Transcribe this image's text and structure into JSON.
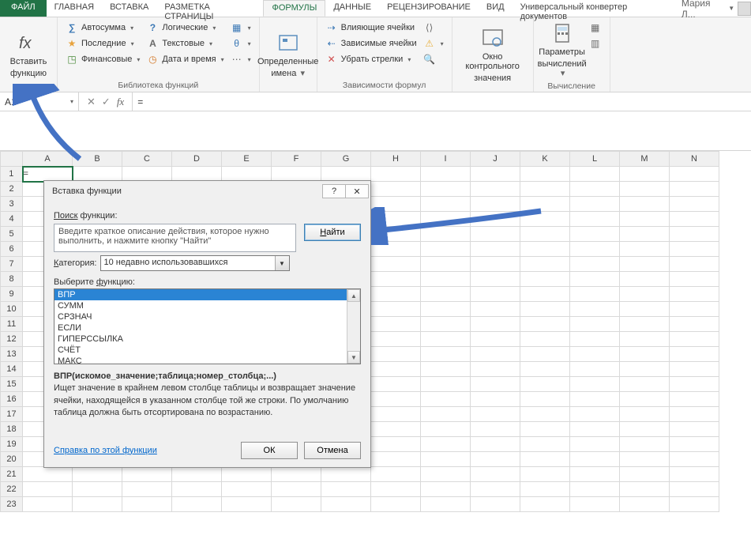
{
  "tabs": {
    "file": "ФАЙЛ",
    "home": "ГЛАВНАЯ",
    "insert": "ВСТАВКА",
    "layout": "РАЗМЕТКА СТРАНИЦЫ",
    "formulas": "ФОРМУЛЫ",
    "data": "ДАННЫЕ",
    "review": "РЕЦЕНЗИРОВАНИЕ",
    "view": "ВИД",
    "converter": "Универсальный конвертер документов",
    "user": "Мария Л..."
  },
  "ribbon": {
    "insert_fn": {
      "top": "Вставить",
      "bottom": "функцию"
    },
    "lib": {
      "autosum": "Автосумма",
      "recent": "Последние",
      "financial": "Финансовые",
      "logical": "Логические",
      "text": "Текстовые",
      "datetime": "Дата и время",
      "group_label": "Библиотека функций"
    },
    "names": {
      "btn_top": "Определенные",
      "btn_bottom": "имена"
    },
    "deps": {
      "precedents": "Влияющие ячейки",
      "dependents": "Зависимые ячейки",
      "remove_arrows": "Убрать стрелки",
      "group_label": "Зависимости формул"
    },
    "watch": {
      "top": "Окно контрольного",
      "bottom": "значения"
    },
    "calc": {
      "top": "Параметры",
      "bottom": "вычислений",
      "group_label": "Вычисление"
    }
  },
  "namebox": "A1",
  "formula": "=",
  "columns": [
    "A",
    "B",
    "C",
    "D",
    "E",
    "F",
    "G",
    "H",
    "I",
    "J",
    "K",
    "L",
    "M",
    "N"
  ],
  "rows": [
    "1",
    "2",
    "3",
    "4",
    "5",
    "6",
    "7",
    "8",
    "9",
    "10",
    "11",
    "12",
    "13",
    "14",
    "15",
    "16",
    "17",
    "18",
    "19",
    "20",
    "21",
    "22",
    "23"
  ],
  "cell_a1": "=",
  "dialog": {
    "title": "Вставка функции",
    "search_label_pre": "Поиск",
    "search_label_post": " функции:",
    "search_text": "Введите краткое описание действия, которое нужно выполнить, и нажмите кнопку \"Найти\"",
    "find_btn": "Найти",
    "category_label_pre": "Категория:",
    "category_underline": "К",
    "category_value": "10 недавно использовавшихся",
    "select_label_pre": "Выберите ",
    "select_label_underline": "ф",
    "select_label_post": "ункцию:",
    "functions": [
      "ВПР",
      "СУММ",
      "СРЗНАЧ",
      "ЕСЛИ",
      "ГИПЕРССЫЛКА",
      "СЧЁТ",
      "МАКС"
    ],
    "signature": "ВПР(искомое_значение;таблица;номер_столбца;...)",
    "description": "Ищет значение в крайнем левом столбце таблицы и возвращает значение ячейки, находящейся в указанном столбце той же строки. По умолчанию таблица должна быть отсортирована по возрастанию.",
    "help_link": "Справка по этой функции",
    "ok": "ОК",
    "cancel": "Отмена"
  }
}
